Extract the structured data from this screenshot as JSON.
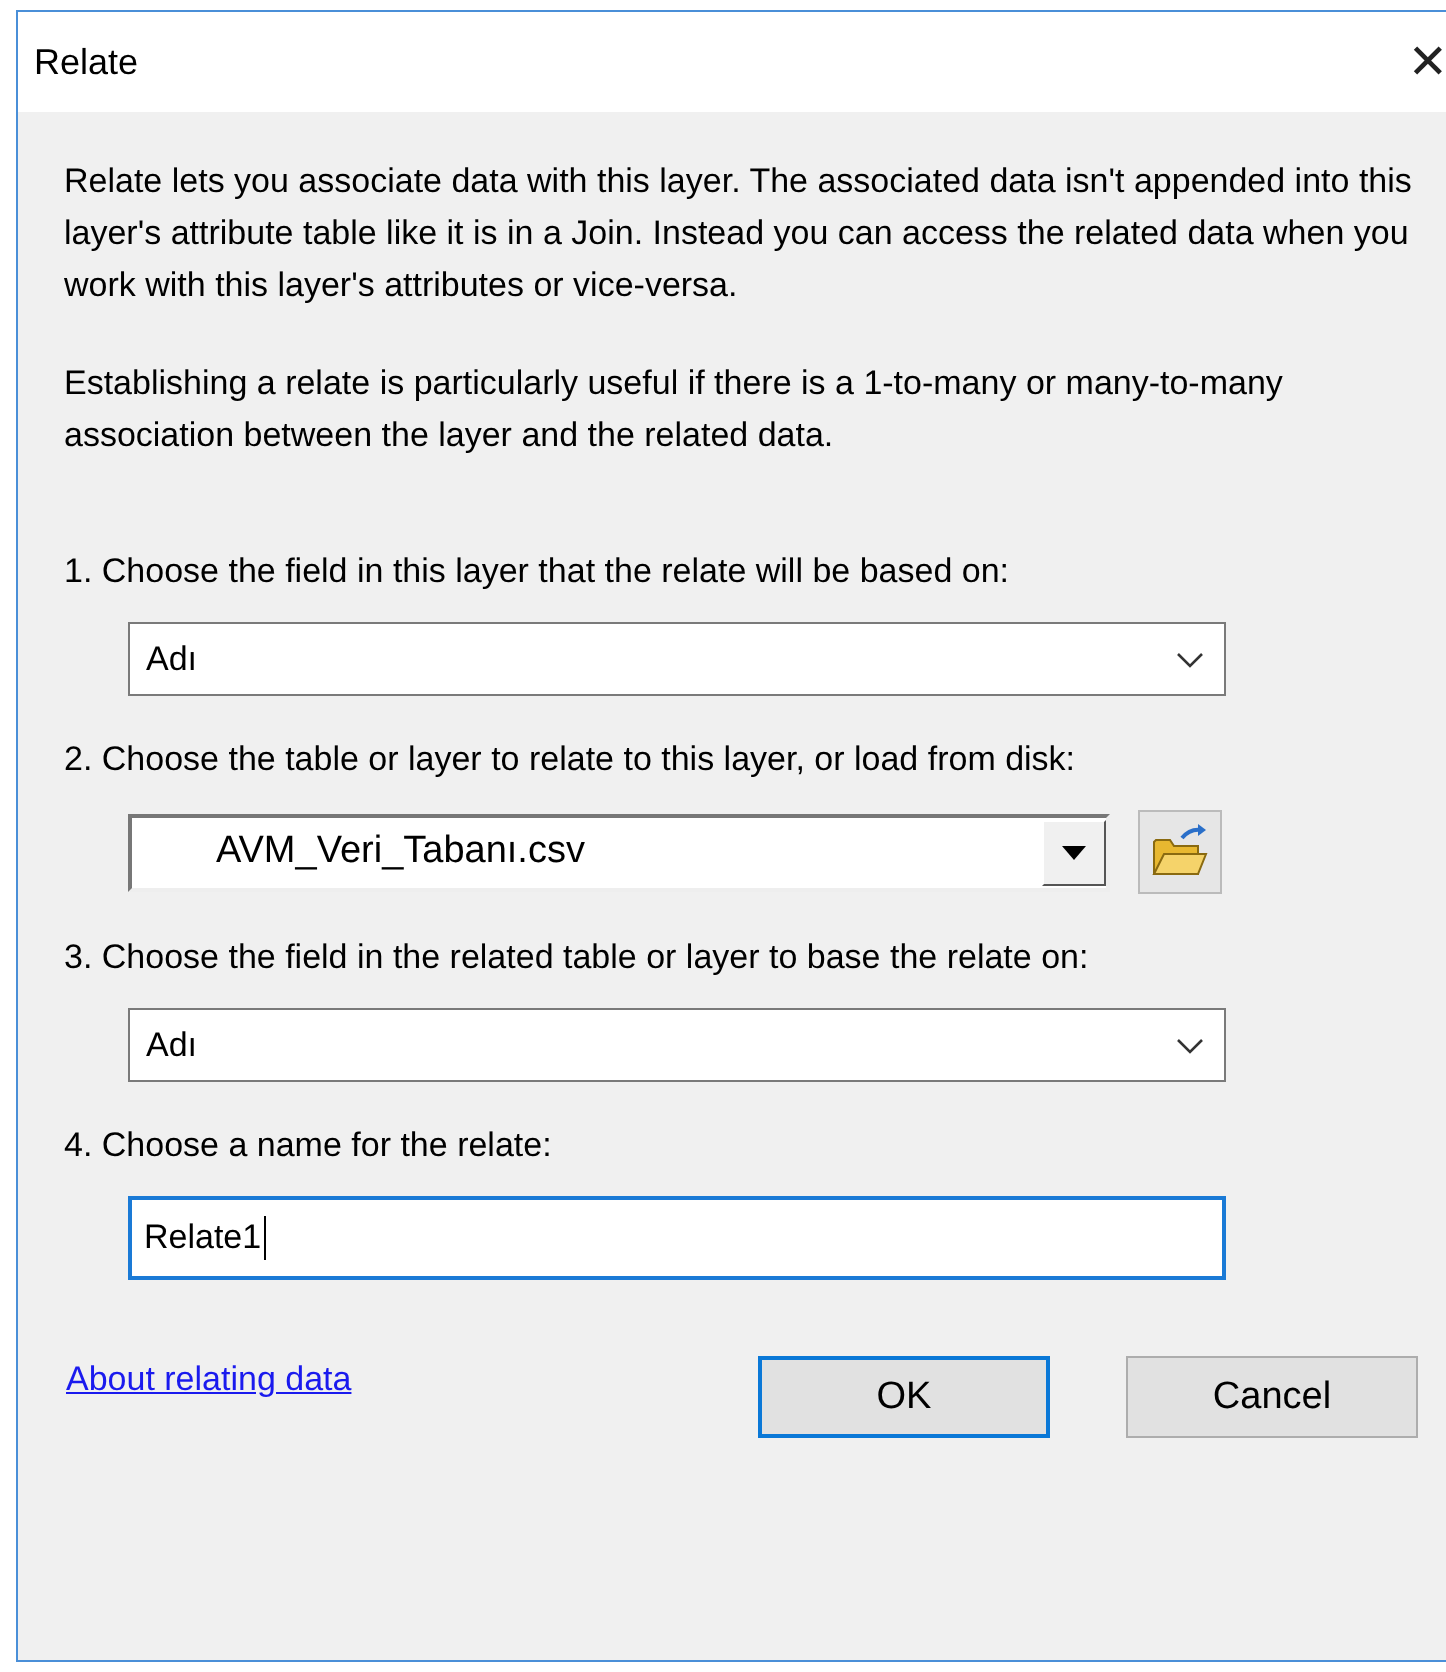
{
  "window": {
    "title": "Relate",
    "close": "✕"
  },
  "paragraphs": [
    "Relate lets you associate data with this layer. The associated data isn't appended into this layer's attribute table like it is in a Join. Instead you can access the related data when you work with this layer's attributes or vice-versa.",
    "Establishing a relate is particularly useful if there is a 1-to-many or many-to-many association between the layer and the related data."
  ],
  "steps": [
    {
      "label": "1. Choose the field in this layer that the relate will be based on:",
      "control": {
        "kind": "combo",
        "value": "Adı"
      }
    },
    {
      "label": "2. Choose the table or layer to relate to this layer, or load from disk:",
      "control": {
        "kind": "classic-combo",
        "value": "AVM_Veri_Tabanı.csv"
      }
    },
    {
      "label": "3. Choose the field in the related table or layer to base the relate on:",
      "control": {
        "kind": "combo",
        "value": "Adı"
      }
    },
    {
      "label": "4. Choose a name for the relate:",
      "control": {
        "kind": "text",
        "value": "Relate1",
        "focused": true
      }
    }
  ],
  "link": "About relating data",
  "buttons": [
    {
      "label": "OK",
      "default": true
    },
    {
      "label": "Cancel",
      "default": false
    }
  ]
}
